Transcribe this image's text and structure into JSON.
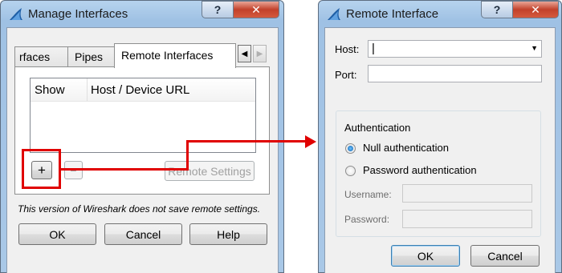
{
  "manage_dialog": {
    "title": "Manage Interfaces",
    "help_glyph": "?",
    "close_glyph": "✕",
    "tabs": [
      "rfaces",
      "Pipes",
      "Remote Interfaces"
    ],
    "scroll_left": "◀",
    "scroll_right": "▶",
    "columns": [
      "Show",
      "Host / Device URL"
    ],
    "add_label": "+",
    "remove_label": "−",
    "remote_settings_label": "Remote Settings",
    "note": "This version of Wireshark does not save remote settings.",
    "ok_label": "OK",
    "cancel_label": "Cancel",
    "help_label": "Help"
  },
  "remote_dialog": {
    "title": "Remote Interface",
    "help_glyph": "?",
    "close_glyph": "✕",
    "host_label": "Host:",
    "host_value": "",
    "host_caret": "|",
    "host_dropdown_glyph": "▼",
    "port_label": "Port:",
    "port_value": "",
    "auth_group_label": "Authentication",
    "null_auth_label": "Null authentication",
    "password_auth_label": "Password authentication",
    "auth_selected": "null",
    "username_label": "Username:",
    "username_value": "",
    "password_label": "Password:",
    "password_value": "",
    "ok_label": "OK",
    "cancel_label": "Cancel"
  },
  "colors": {
    "annotation_red": "#e00000",
    "titlebar_blue": "#a9c8e7",
    "window_face": "#f0f0f0"
  }
}
